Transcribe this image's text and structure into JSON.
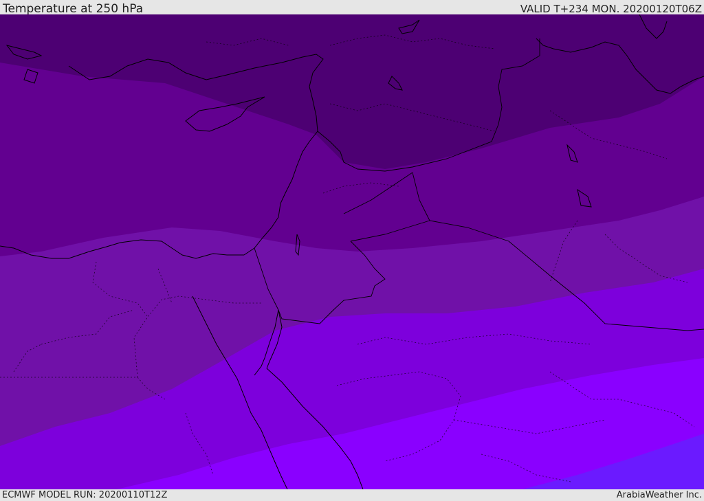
{
  "header": {
    "title": "Temperature at 250 hPa",
    "valid": "VALID T+234 MON. 20200120T06Z"
  },
  "footer": {
    "model_run": "ECMWF MODEL RUN: 20200110T12Z",
    "brand": "ArabiaWeather Inc."
  },
  "colors": {
    "band_darkest": "#4d0073",
    "band_dark": "#620090",
    "band_mid": "#7011a8",
    "band_bright": "#7d00dc",
    "band_brighter": "#8a00ff",
    "band_blue": "#6b1aff",
    "coastline": "#000000"
  }
}
